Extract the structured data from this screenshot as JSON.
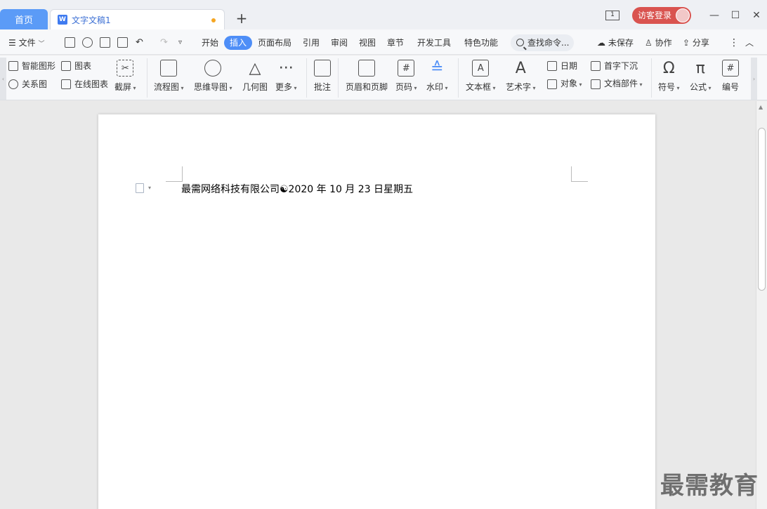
{
  "tabs": {
    "home": "首页",
    "doc_badge": "W",
    "doc": "文字文稿1",
    "add": "+"
  },
  "window": {
    "page_indicator": "1",
    "guest_login": "访客登录",
    "minimize": "—",
    "maximize": "☐",
    "close": "✕"
  },
  "menu": {
    "file": "文件",
    "items": [
      "开始",
      "插入",
      "页面布局",
      "引用",
      "审阅",
      "视图",
      "章节",
      "开发工具",
      "特色功能"
    ],
    "active_index": 1,
    "search_placeholder": "查找命令...",
    "unsaved": "未保存",
    "collaborate": "协作",
    "share": "分享"
  },
  "ribbon": {
    "smart_shape": "智能图形",
    "chart": "图表",
    "relation": "关系图",
    "online_chart": "在线图表",
    "screenshot": "截屏",
    "flowchart": "流程图",
    "mindmap": "思维导图",
    "geometry": "几何图",
    "more": "更多",
    "comment": "批注",
    "header_footer": "页眉和页脚",
    "page_number": "页码",
    "watermark": "水印",
    "textbox": "文本框",
    "wordart": "艺术字",
    "date": "日期",
    "object": "对象",
    "dropcap": "首字下沉",
    "doc_parts": "文档部件",
    "symbol": "符号",
    "formula": "公式",
    "numbering": "编号"
  },
  "document": {
    "text": "最需网络科技有限公司☯2020 年 10 月 23 日星期五"
  },
  "overlay": {
    "watermark": "最需教育"
  }
}
